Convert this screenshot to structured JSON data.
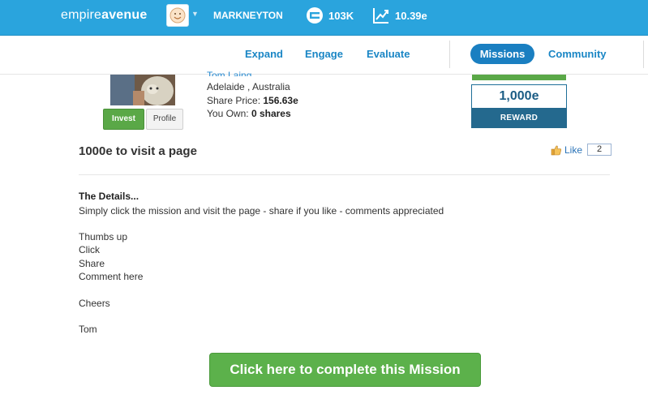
{
  "header": {
    "logo_prefix": "empire",
    "logo_bold": "avenue",
    "username": "MARKNEYTON",
    "networth": "103K",
    "share_price": "10.39e",
    "bar_color": "#2aa4dd"
  },
  "subnav": {
    "expand": "Expand",
    "engage": "Engage",
    "evaluate": "Evaluate",
    "missions": "Missions",
    "community": "Community"
  },
  "owner": {
    "name": "Tom Laing",
    "location": "Adelaide , Australia",
    "share_price_label": "Share Price:",
    "share_price_value": "156.63e",
    "you_own_label": "You Own:",
    "you_own_value": "0 shares",
    "invest_label": "Invest",
    "profile_label": "Profile"
  },
  "reward": {
    "amount": "1,000e",
    "label": "REWARD"
  },
  "mission": {
    "title": "1000e to visit a page",
    "like_label": "Like",
    "like_count": "2",
    "details_heading": "The Details...",
    "lines": [
      "Simply click the mission and visit the page - share if you like - comments appreciated",
      "Thumbs up",
      "Click",
      "Share",
      "Comment here",
      "Cheers",
      "Tom"
    ],
    "cta_label": "Click here to complete this Mission"
  }
}
